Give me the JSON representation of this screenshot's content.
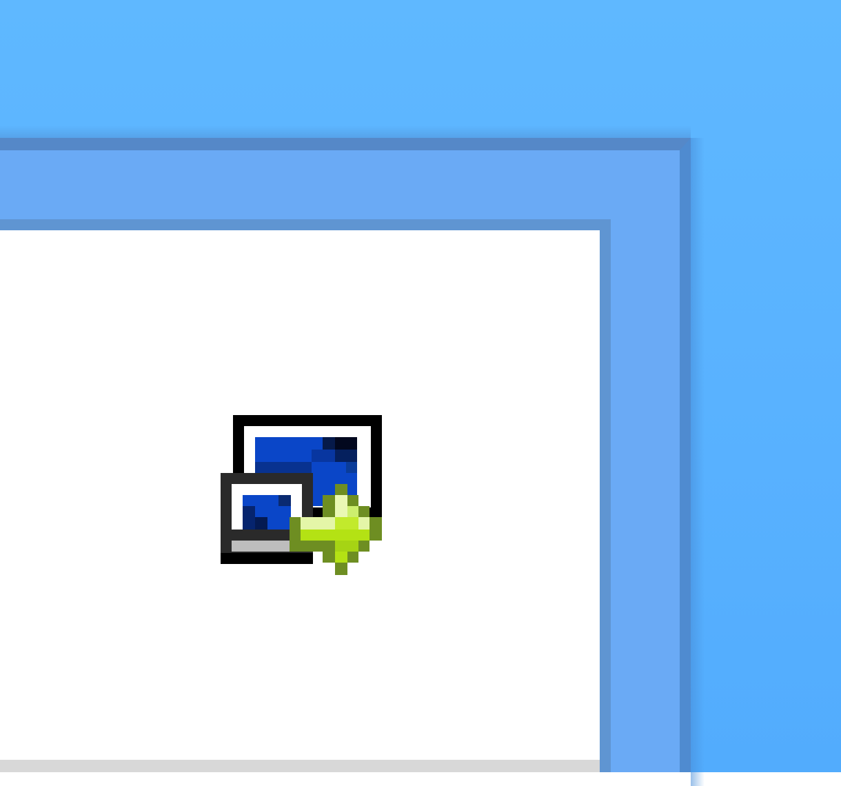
{
  "screen": {
    "background_color": "#5cb6ff",
    "frame_color": "#6aaaf5",
    "frame_border_color": "#5588c8",
    "panel_color": "#ffffff",
    "panel_border_color": "#5f95d2"
  },
  "icon": {
    "name": "window-restore-arrow-icon",
    "colors": {
      "outline": "#000000",
      "screen_blue": "#0a46c8",
      "screen_dark": "#06246e",
      "arrow_light": "#e4f6a8",
      "arrow_mid": "#b4e214",
      "arrow_dark": "#6e8e22",
      "taskbar_gray": "#bdbdbd"
    }
  }
}
